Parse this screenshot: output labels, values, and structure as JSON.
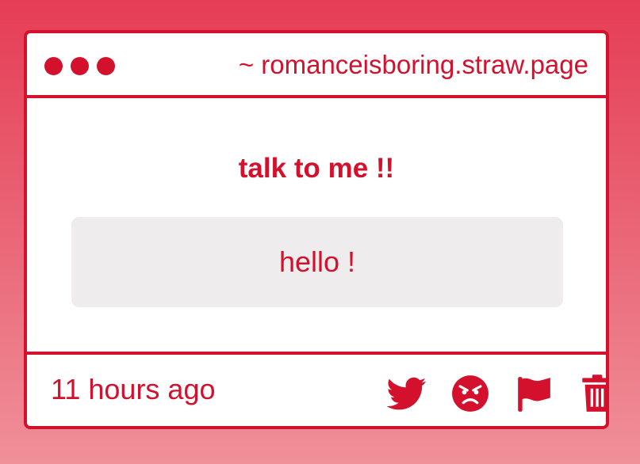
{
  "window": {
    "url": "~ romanceisboring.straw.page",
    "accent": "#d4112d"
  },
  "prompt": "talk to me !!",
  "message": "hello !",
  "footer": {
    "timestamp": "11 hours ago",
    "actions": [
      {
        "icon": "twitter-icon"
      },
      {
        "icon": "angry-face-icon"
      },
      {
        "icon": "flag-icon"
      },
      {
        "icon": "trash-icon"
      }
    ]
  }
}
